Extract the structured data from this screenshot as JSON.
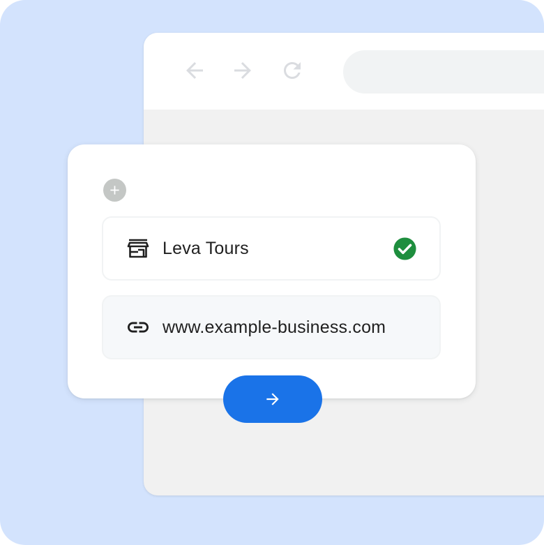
{
  "colors": {
    "backdrop": "#d3e3fd",
    "accent": "#1a73e8",
    "success": "#1e8e3e",
    "icon_muted": "#c4c7c5"
  },
  "browser": {
    "nav_icons": [
      "arrow-back-icon",
      "arrow-forward-icon",
      "reload-icon"
    ],
    "address_bar_value": ""
  },
  "form": {
    "add_icon": "plus-icon",
    "business_name": {
      "icon": "storefront-icon",
      "value": "Leva Tours",
      "status_icon": "check-circle-icon"
    },
    "website": {
      "icon": "link-icon",
      "value": "www.example-business.com"
    },
    "next_button_icon": "arrow-forward-icon"
  }
}
